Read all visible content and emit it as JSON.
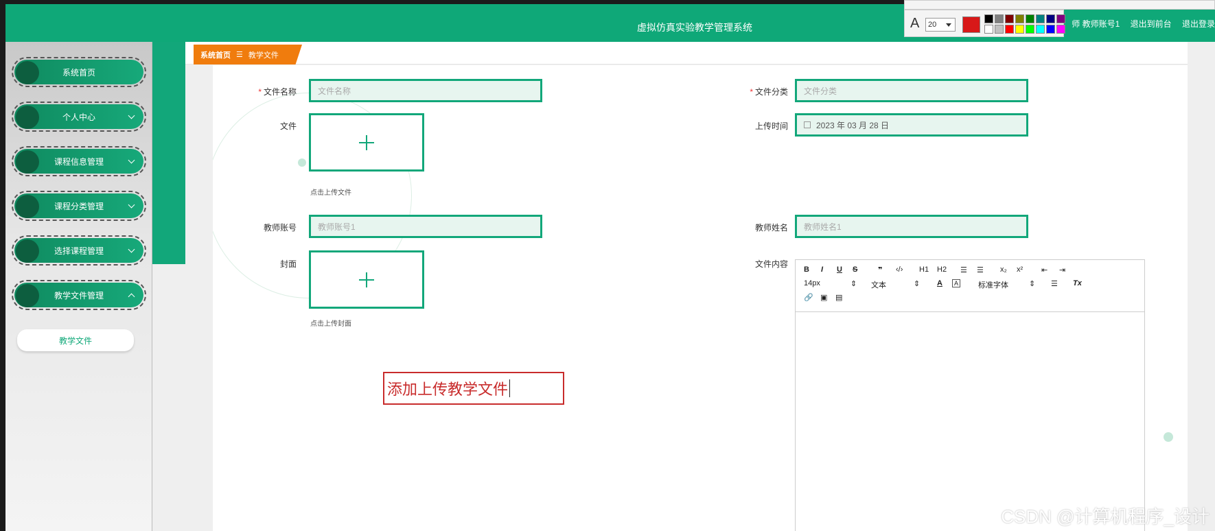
{
  "header": {
    "app_title": "虚拟仿真实验教学管理系统",
    "user_prefix": "师 教师账号1",
    "back_link": "退出到前台",
    "logout": "退出登录"
  },
  "sidebar": {
    "items": [
      {
        "label": "系统首页"
      },
      {
        "label": "个人中心"
      },
      {
        "label": "课程信息管理"
      },
      {
        "label": "课程分类管理"
      },
      {
        "label": "选择课程管理"
      },
      {
        "label": "教学文件管理"
      }
    ],
    "submenu": {
      "label": "教学文件"
    }
  },
  "breadcrumb": {
    "home": "系统首页",
    "separator": "☰",
    "current": "教学文件"
  },
  "form": {
    "file_name": {
      "label": "文件名称",
      "placeholder": "文件名称"
    },
    "file_category": {
      "label": "文件分类",
      "placeholder": "文件分类"
    },
    "file": {
      "label": "文件",
      "hint": "点击上传文件"
    },
    "upload_time": {
      "label": "上传时间",
      "value": "2023 年 03 月 28 日"
    },
    "teacher_account": {
      "label": "教师账号",
      "value": "教师账号1"
    },
    "teacher_name": {
      "label": "教师姓名",
      "value": "教师姓名1"
    },
    "cover": {
      "label": "封面",
      "hint": "点击上传封面"
    },
    "file_content": {
      "label": "文件内容"
    }
  },
  "editor_toolbar": {
    "bold": "B",
    "italic": "I",
    "underline": "U",
    "strike": "S",
    "quote": "❞",
    "code": "‹/›",
    "h1": "H1",
    "h2": "H2",
    "ol": "☰",
    "ul": "☰",
    "sub": "x₂",
    "sup": "x²",
    "outdent": "⇤",
    "indent": "⇥",
    "size": "14px",
    "type": "文本",
    "font": "标准字体",
    "clean": "Tx"
  },
  "annotation": {
    "text": "添加上传教学文件"
  },
  "draw_toolbar": {
    "font_label": "A",
    "font_size": "20",
    "current_color": "#d81818",
    "palette": [
      "#000000",
      "#808080",
      "#800000",
      "#808000",
      "#008000",
      "#008080",
      "#000080",
      "#800080",
      "#ffffff",
      "#c0c0c0",
      "#ff0000",
      "#ffff00",
      "#00ff00",
      "#00ffff",
      "#0000ff",
      "#ff00ff"
    ]
  },
  "watermark": "CSDN @计算机程序_设计"
}
